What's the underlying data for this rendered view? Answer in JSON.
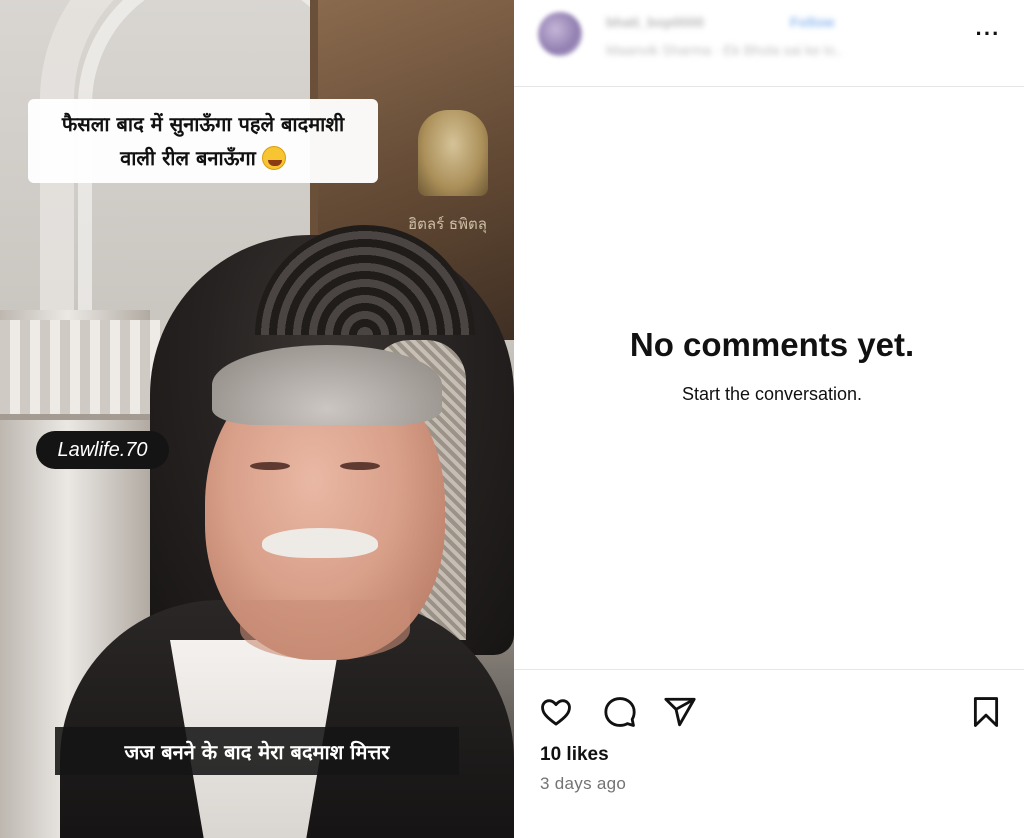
{
  "media": {
    "caption_line1": "फैसला बाद में सुनाऊँगा पहले बादमाशी",
    "caption_line2": "वाली रील बनाऊँगा",
    "caption_emoji": "rolling-on-floor-laughing-emoji",
    "watermark": "Lawlife.70",
    "subtitle": "जज बनने के बाद मेरा बदमाश मित्तर",
    "panel_text": "ฮิตลร์ ธพิตลุ"
  },
  "header": {
    "username": "bhati_bop0000",
    "follow_label": "Follow",
    "audio": "Maanvik Sharma · Ek Bhola sai ke lo..",
    "more_icon": "more-horizontal-icon",
    "more_label": "···"
  },
  "comments": {
    "empty_title": "No comments yet.",
    "empty_subtitle": "Start the conversation."
  },
  "footer": {
    "likes": "10 likes",
    "time": "3 days ago",
    "icons": [
      "heart-icon",
      "comment-icon",
      "share-icon",
      "bookmark-icon"
    ]
  },
  "colors": {
    "text": "#111111",
    "muted": "#737373",
    "divider": "#e6e6e6",
    "link": "#0095f6"
  }
}
